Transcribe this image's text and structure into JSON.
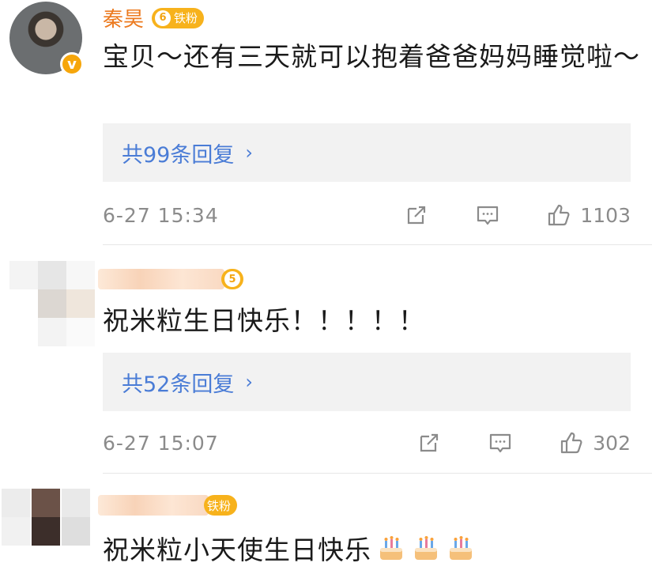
{
  "comments": [
    {
      "username": "秦昊",
      "fan_badge": "铁粉",
      "fan_level": "6",
      "verified_mark": "v",
      "text": "宝贝～还有三天就可以抱着爸爸妈妈睡觉啦～",
      "replies": "共99条回复",
      "timestamp": "6-27 15:34",
      "likes": "1103"
    },
    {
      "username": "",
      "fan_level": "5",
      "text": "祝米粒生日快乐！！！！！",
      "replies": "共52条回复",
      "timestamp": "6-27 15:07",
      "likes": "302"
    },
    {
      "username": "",
      "fan_badge": "铁粉",
      "text": "祝米粒小天使生日快乐",
      "emoji_count": 3
    }
  ],
  "icons": {
    "share": "share-icon",
    "comment": "comment-icon",
    "like": "thumbs-up-icon",
    "chevron": "chevron-right-icon",
    "cake": "birthday-cake-emoji"
  },
  "colors": {
    "username": "#ec7a1f",
    "reply_link": "#4a7cd6",
    "meta": "#8b8b8b",
    "fan_badge": "#f7b21c"
  }
}
